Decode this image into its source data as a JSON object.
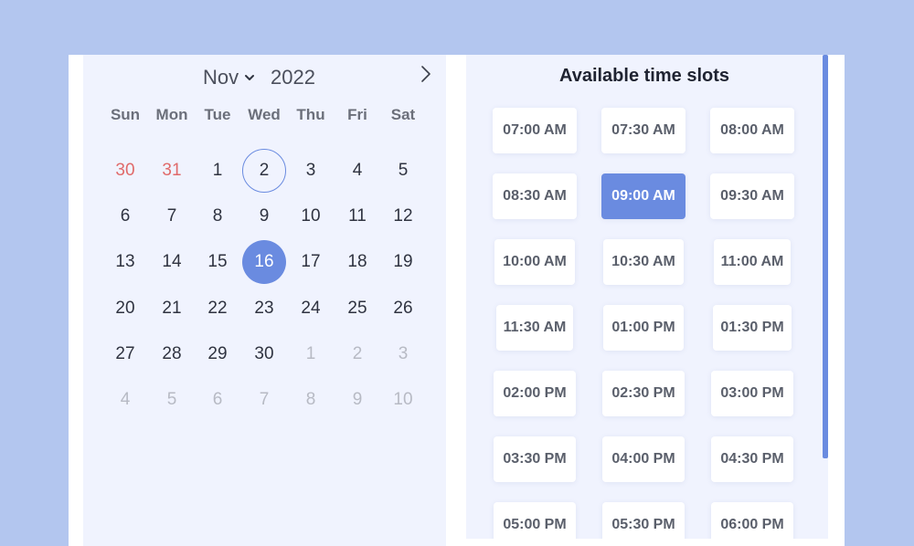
{
  "calendar": {
    "month": "Nov",
    "year": "2022",
    "weekdays": [
      "Sun",
      "Mon",
      "Tue",
      "Wed",
      "Thu",
      "Fri",
      "Sat"
    ],
    "weeks": [
      [
        "30",
        "31",
        "1",
        "2",
        "3",
        "4",
        "5"
      ],
      [
        "6",
        "7",
        "8",
        "9",
        "10",
        "11",
        "12"
      ],
      [
        "13",
        "14",
        "15",
        "16",
        "17",
        "18",
        "19"
      ],
      [
        "20",
        "21",
        "22",
        "23",
        "24",
        "25",
        "26"
      ],
      [
        "27",
        "28",
        "29",
        "30",
        "1",
        "2",
        "3"
      ],
      [
        "4",
        "5",
        "6",
        "7",
        "8",
        "9",
        "10"
      ]
    ],
    "today": "2",
    "selected": "16"
  },
  "slots": {
    "title": "Available time slots",
    "times": [
      "07:00 AM",
      "07:30 AM",
      "08:00 AM",
      "08:30 AM",
      "09:00 AM",
      "09:30 AM",
      "10:00 AM",
      "10:30 AM",
      "11:00 AM",
      "11:30 AM",
      "01:00 PM",
      "01:30 PM",
      "02:00 PM",
      "02:30 PM",
      "03:00 PM",
      "03:30 PM",
      "04:00 PM",
      "04:30 PM",
      "05:00 PM",
      "05:30 PM",
      "06:00 PM"
    ],
    "selected": "09:00 AM"
  },
  "colors": {
    "accent": "#6a8be0",
    "prev_month_day": "#e06a6a",
    "next_month_day": "#b7bac4",
    "background": "#b3c6ef",
    "panel": "#f0f3fe"
  },
  "icons": {
    "month_dropdown": "chevron-down-icon",
    "next_month": "chevron-right-icon"
  }
}
